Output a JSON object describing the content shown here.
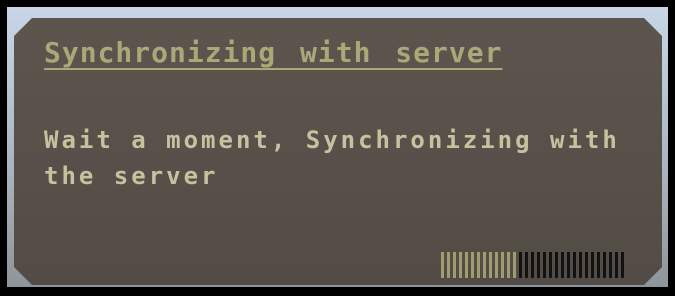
{
  "dialog": {
    "title": "Synchronizing with server",
    "message": "Wait a moment, Synchronizing with the server",
    "progress": {
      "fraction": 0.42,
      "segments": 31
    }
  },
  "colors": {
    "panel": "#575049",
    "title": "#a9a877",
    "message": "#c6c2a0",
    "progress_on": "#9f9d70",
    "progress_off": "#121212"
  }
}
